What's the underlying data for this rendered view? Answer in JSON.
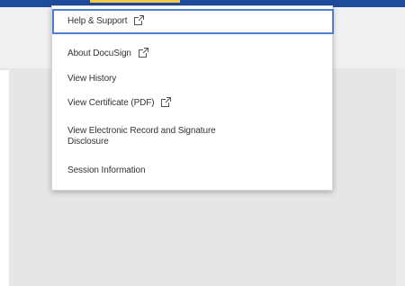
{
  "menu": {
    "items": [
      {
        "label": "Help & Support",
        "icon": "external-link-icon"
      },
      {
        "label": "About DocuSign",
        "icon": "external-link-icon"
      },
      {
        "label": "View History"
      },
      {
        "label": "View Certificate (PDF)",
        "icon": "external-link-icon"
      },
      {
        "label": "View Electronic Record and Signature",
        "label_line2": "Disclosure"
      },
      {
        "label": "Session Information"
      }
    ]
  },
  "colors": {
    "top_bar": "#1e4b9b",
    "accent": "#f2c94c",
    "focus_border": "#4f7fcf",
    "menu_text": "#333333"
  }
}
